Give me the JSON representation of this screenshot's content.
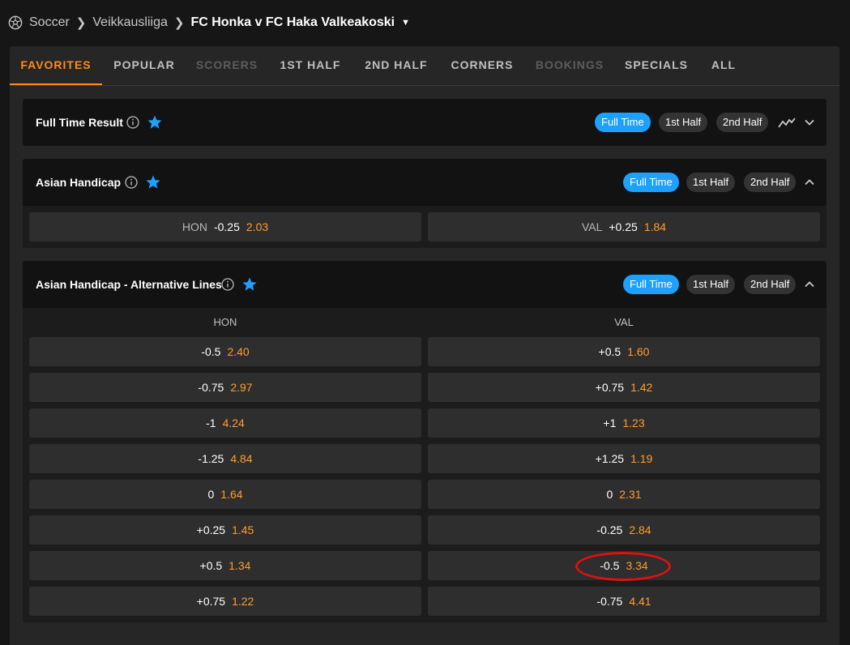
{
  "breadcrumb": {
    "sport": "Soccer",
    "league": "Veikkausliiga",
    "match": "FC Honka v FC Haka Valkeakoski"
  },
  "tabs": [
    {
      "label": "FAVORITES",
      "state": "active"
    },
    {
      "label": "POPULAR",
      "state": "normal"
    },
    {
      "label": "SCORERS",
      "state": "disabled"
    },
    {
      "label": "1ST HALF",
      "state": "normal"
    },
    {
      "label": "2ND HALF",
      "state": "normal"
    },
    {
      "label": "CORNERS",
      "state": "normal"
    },
    {
      "label": "BOOKINGS",
      "state": "disabled"
    },
    {
      "label": "SPECIALS",
      "state": "normal"
    },
    {
      "label": "ALL",
      "state": "normal"
    }
  ],
  "period_options": [
    "Full Time",
    "1st Half",
    "2nd Half"
  ],
  "selected_period": "Full Time",
  "markets": {
    "full_time_result": {
      "title": "Full Time Result",
      "expanded": false
    },
    "asian_handicap": {
      "title": "Asian Handicap",
      "expanded": true,
      "selections": [
        {
          "team": "HON",
          "line": "-0.25",
          "odds": "2.03"
        },
        {
          "team": "VAL",
          "line": "+0.25",
          "odds": "1.84"
        }
      ]
    },
    "asian_handicap_alt": {
      "title": "Asian Handicap - Alternative Lines",
      "expanded": true,
      "columns": [
        "HON",
        "VAL"
      ],
      "rows": [
        [
          {
            "line": "-0.5",
            "odds": "2.40"
          },
          {
            "line": "+0.5",
            "odds": "1.60"
          }
        ],
        [
          {
            "line": "-0.75",
            "odds": "2.97"
          },
          {
            "line": "+0.75",
            "odds": "1.42"
          }
        ],
        [
          {
            "line": "-1",
            "odds": "4.24"
          },
          {
            "line": "+1",
            "odds": "1.23"
          }
        ],
        [
          {
            "line": "-1.25",
            "odds": "4.84"
          },
          {
            "line": "+1.25",
            "odds": "1.19"
          }
        ],
        [
          {
            "line": "0",
            "odds": "1.64"
          },
          {
            "line": "0",
            "odds": "2.31"
          }
        ],
        [
          {
            "line": "+0.25",
            "odds": "1.45"
          },
          {
            "line": "-0.25",
            "odds": "2.84"
          }
        ],
        [
          {
            "line": "+0.5",
            "odds": "1.34"
          },
          {
            "line": "-0.5",
            "odds": "3.34"
          }
        ],
        [
          {
            "line": "+0.75",
            "odds": "1.22"
          },
          {
            "line": "-0.75",
            "odds": "4.41"
          }
        ]
      ]
    }
  },
  "colors": {
    "accent": "#ff8c1a",
    "odds": "#ff9d2e",
    "pill_active": "#1ea0ff",
    "star": "#1ea0ff",
    "highlight": "#e01010"
  }
}
